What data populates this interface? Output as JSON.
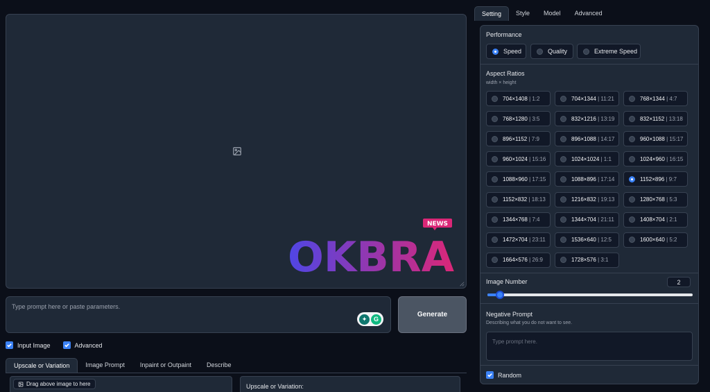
{
  "prompt": {
    "placeholder": "Type prompt here or paste parameters."
  },
  "generate_label": "Generate",
  "watermark": {
    "word": "OKBRA",
    "badge": "NEWS"
  },
  "checkboxes": [
    {
      "label": "Input Image",
      "checked": true
    },
    {
      "label": "Advanced",
      "checked": true
    }
  ],
  "left_tabs": [
    "Upscale or Variation",
    "Image Prompt",
    "Inpaint or Outpaint",
    "Describe"
  ],
  "drag_label": "Drag above image to here",
  "upscale_label": "Upscale or Variation:",
  "right_tabs": [
    "Setting",
    "Style",
    "Model",
    "Advanced"
  ],
  "performance": {
    "label": "Performance",
    "options": [
      "Speed",
      "Quality",
      "Extreme Speed"
    ],
    "selected": "Speed"
  },
  "aspect_ratios": {
    "label": "Aspect Ratios",
    "sub": "width × height",
    "selected": "1152×896",
    "items": [
      {
        "size": "704×1408",
        "ratio": "| 1:2"
      },
      {
        "size": "704×1344",
        "ratio": "| 11:21"
      },
      {
        "size": "768×1344",
        "ratio": "| 4:7"
      },
      {
        "size": "768×1280",
        "ratio": "| 3:5"
      },
      {
        "size": "832×1216",
        "ratio": "| 13:19"
      },
      {
        "size": "832×1152",
        "ratio": "| 13:18"
      },
      {
        "size": "896×1152",
        "ratio": "| 7:9"
      },
      {
        "size": "896×1088",
        "ratio": "| 14:17"
      },
      {
        "size": "960×1088",
        "ratio": "| 15:17"
      },
      {
        "size": "960×1024",
        "ratio": "| 15:16"
      },
      {
        "size": "1024×1024",
        "ratio": "| 1:1"
      },
      {
        "size": "1024×960",
        "ratio": "| 16:15"
      },
      {
        "size": "1088×960",
        "ratio": "| 17:15"
      },
      {
        "size": "1088×896",
        "ratio": "| 17:14"
      },
      {
        "size": "1152×896",
        "ratio": "| 9:7"
      },
      {
        "size": "1152×832",
        "ratio": "| 18:13"
      },
      {
        "size": "1216×832",
        "ratio": "| 19:13"
      },
      {
        "size": "1280×768",
        "ratio": "| 5:3"
      },
      {
        "size": "1344×768",
        "ratio": "| 7:4"
      },
      {
        "size": "1344×704",
        "ratio": "| 21:11"
      },
      {
        "size": "1408×704",
        "ratio": "| 2:1"
      },
      {
        "size": "1472×704",
        "ratio": "| 23:11"
      },
      {
        "size": "1536×640",
        "ratio": "| 12:5"
      },
      {
        "size": "1600×640",
        "ratio": "| 5:2"
      },
      {
        "size": "1664×576",
        "ratio": "| 26:9"
      },
      {
        "size": "1728×576",
        "ratio": "| 3:1"
      }
    ]
  },
  "image_number": {
    "label": "Image Number",
    "value": "2",
    "fraction": 0.06
  },
  "negative_prompt": {
    "label": "Negative Prompt",
    "sub": "Describing what you do not want to see.",
    "placeholder": "Type prompt here."
  },
  "random": {
    "label": "Random",
    "checked": true
  },
  "colors": {
    "accent": "#3b82f6",
    "background": "#0b0f19",
    "panel": "#1f2937",
    "border": "#374151"
  }
}
